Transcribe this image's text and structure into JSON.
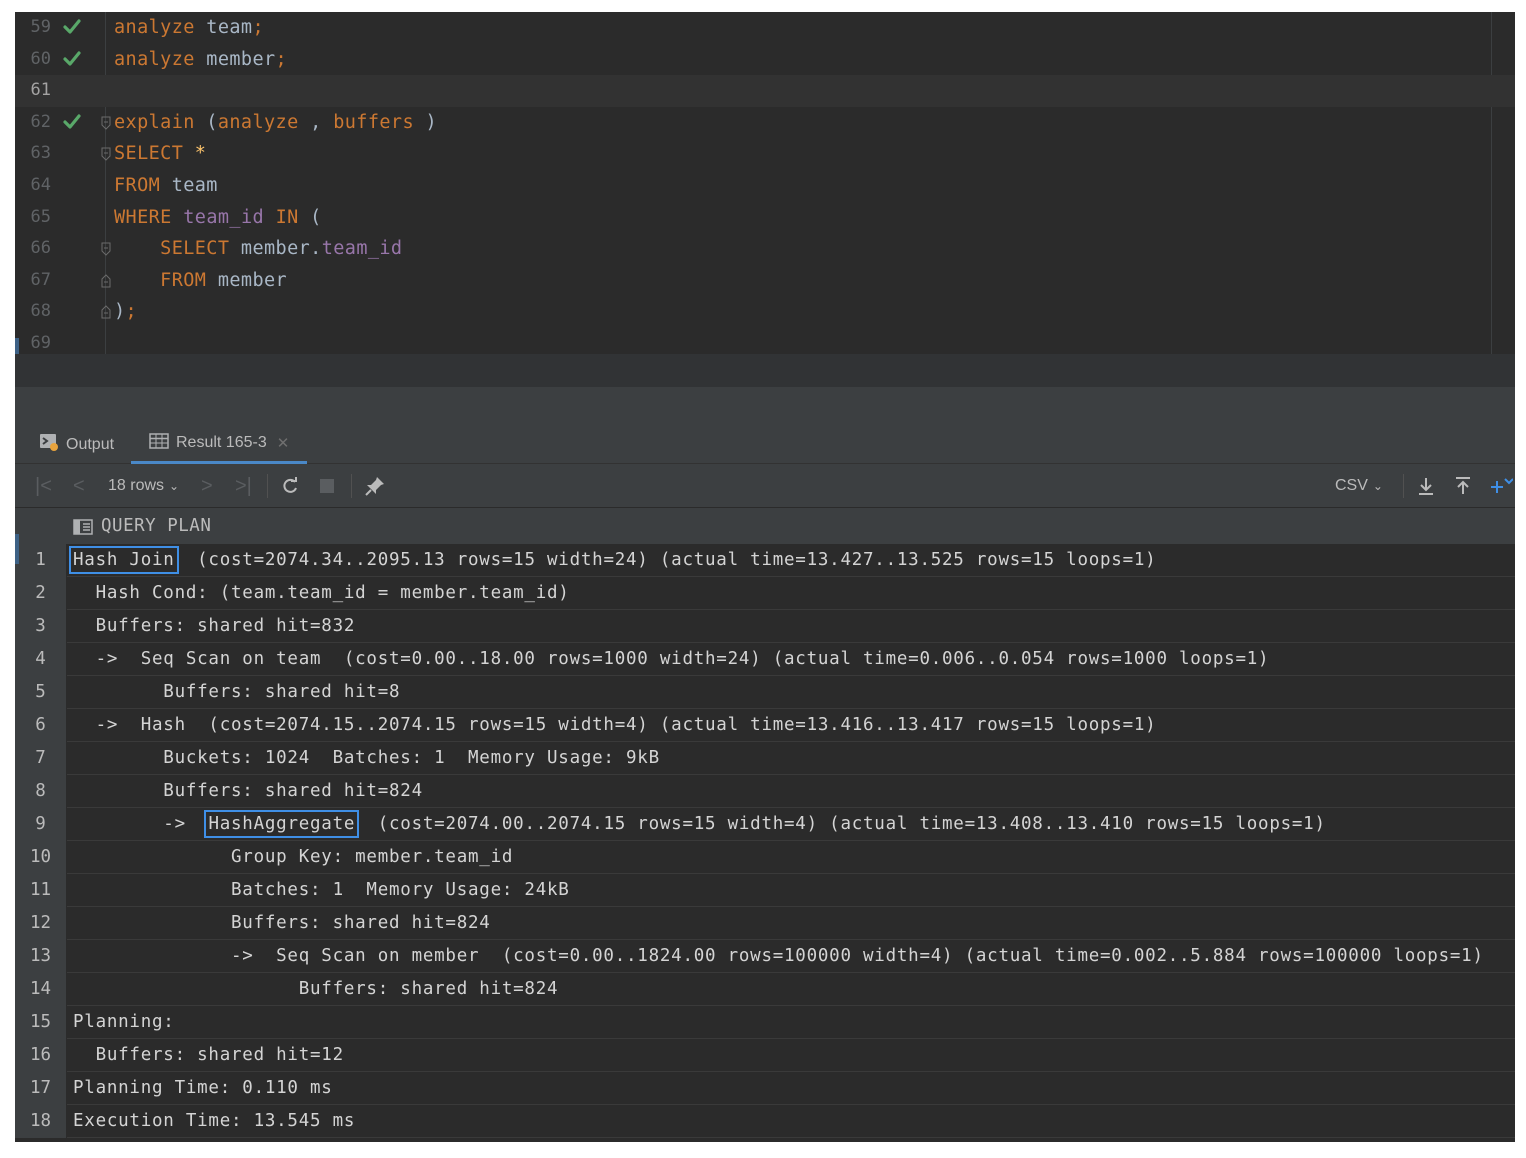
{
  "editor": {
    "lines": [
      {
        "num": "59",
        "status": "check-icon",
        "tokens": [
          {
            "t": "analyze",
            "c": "kw"
          },
          {
            "t": " team",
            "c": ""
          },
          {
            "t": ";",
            "c": "kw"
          }
        ]
      },
      {
        "num": "60",
        "status": "check-icon",
        "tokens": [
          {
            "t": "analyze",
            "c": "kw"
          },
          {
            "t": " member",
            "c": ""
          },
          {
            "t": ";",
            "c": "kw"
          }
        ]
      },
      {
        "num": "61",
        "status": "",
        "current": true,
        "tokens": []
      },
      {
        "num": "62",
        "status": "check-icon",
        "fold": "open",
        "tokens": [
          {
            "t": "explain",
            "c": "kw"
          },
          {
            "t": " (",
            "c": ""
          },
          {
            "t": "analyze",
            "c": "kw"
          },
          {
            "t": " , ",
            "c": ""
          },
          {
            "t": "buffers",
            "c": "kw"
          },
          {
            "t": " )",
            "c": ""
          }
        ]
      },
      {
        "num": "63",
        "status": "",
        "fold": "open",
        "tokens": [
          {
            "t": "SELECT",
            "c": "kw"
          },
          {
            "t": " ",
            "c": ""
          },
          {
            "t": "*",
            "c": "star"
          }
        ]
      },
      {
        "num": "64",
        "status": "",
        "tokens": [
          {
            "t": "FROM",
            "c": "kw"
          },
          {
            "t": " team",
            "c": ""
          }
        ]
      },
      {
        "num": "65",
        "status": "",
        "tokens": [
          {
            "t": "WHERE",
            "c": "kw"
          },
          {
            "t": " ",
            "c": ""
          },
          {
            "t": "team_id",
            "c": "col"
          },
          {
            "t": " ",
            "c": ""
          },
          {
            "t": "IN",
            "c": "kw"
          },
          {
            "t": " (",
            "c": ""
          }
        ]
      },
      {
        "num": "66",
        "status": "",
        "fold": "open",
        "tokens": [
          {
            "t": "    SELECT",
            "c": "kw"
          },
          {
            "t": " member.",
            "c": ""
          },
          {
            "t": "team_id",
            "c": "col"
          }
        ]
      },
      {
        "num": "67",
        "status": "",
        "fold": "close",
        "tokens": [
          {
            "t": "    FROM",
            "c": "kw"
          },
          {
            "t": " member",
            "c": ""
          }
        ]
      },
      {
        "num": "68",
        "status": "",
        "fold": "close",
        "tokens": [
          {
            "t": ")",
            "c": ""
          },
          {
            "t": ";",
            "c": "kw"
          }
        ]
      },
      {
        "num": "69",
        "status": "",
        "tokens": []
      }
    ]
  },
  "tabs": {
    "output_label": "Output",
    "result_label": "Result 165-3"
  },
  "toolbar": {
    "rows_label": "18 rows",
    "export_format": "CSV"
  },
  "grid": {
    "column_header": "QUERY PLAN",
    "rows": [
      {
        "n": "1",
        "pre": "",
        "hl": "Hash Join",
        "post": "  (cost=2074.34..2095.13 rows=15 width=24) (actual time=13.427..13.525 rows=15 loops=1)"
      },
      {
        "n": "2",
        "text": "  Hash Cond: (team.team_id = member.team_id)"
      },
      {
        "n": "3",
        "text": "  Buffers: shared hit=832"
      },
      {
        "n": "4",
        "text": "  ->  Seq Scan on team  (cost=0.00..18.00 rows=1000 width=24) (actual time=0.006..0.054 rows=1000 loops=1)"
      },
      {
        "n": "5",
        "text": "        Buffers: shared hit=8"
      },
      {
        "n": "6",
        "text": "  ->  Hash  (cost=2074.15..2074.15 rows=15 width=4) (actual time=13.416..13.417 rows=15 loops=1)"
      },
      {
        "n": "7",
        "text": "        Buckets: 1024  Batches: 1  Memory Usage: 9kB"
      },
      {
        "n": "8",
        "text": "        Buffers: shared hit=824"
      },
      {
        "n": "9",
        "pre": "        ->  ",
        "hl": "HashAggregate",
        "post": "  (cost=2074.00..2074.15 rows=15 width=4) (actual time=13.408..13.410 rows=15 loops=1)"
      },
      {
        "n": "10",
        "text": "              Group Key: member.team_id"
      },
      {
        "n": "11",
        "text": "              Batches: 1  Memory Usage: 24kB"
      },
      {
        "n": "12",
        "text": "              Buffers: shared hit=824"
      },
      {
        "n": "13",
        "text": "              ->  Seq Scan on member  (cost=0.00..1824.00 rows=100000 width=4) (actual time=0.002..5.884 rows=100000 loops=1)"
      },
      {
        "n": "14",
        "text": "                    Buffers: shared hit=824"
      },
      {
        "n": "15",
        "text": "Planning:"
      },
      {
        "n": "16",
        "text": "  Buffers: shared hit=12"
      },
      {
        "n": "17",
        "text": "Planning Time: 0.110 ms"
      },
      {
        "n": "18",
        "text": "Execution Time: 13.545 ms"
      }
    ]
  },
  "colors": {
    "keyword": "#cc7832",
    "identifier": "#9876aa",
    "highlight_box": "#3f8fe6",
    "check": "#59a869"
  }
}
